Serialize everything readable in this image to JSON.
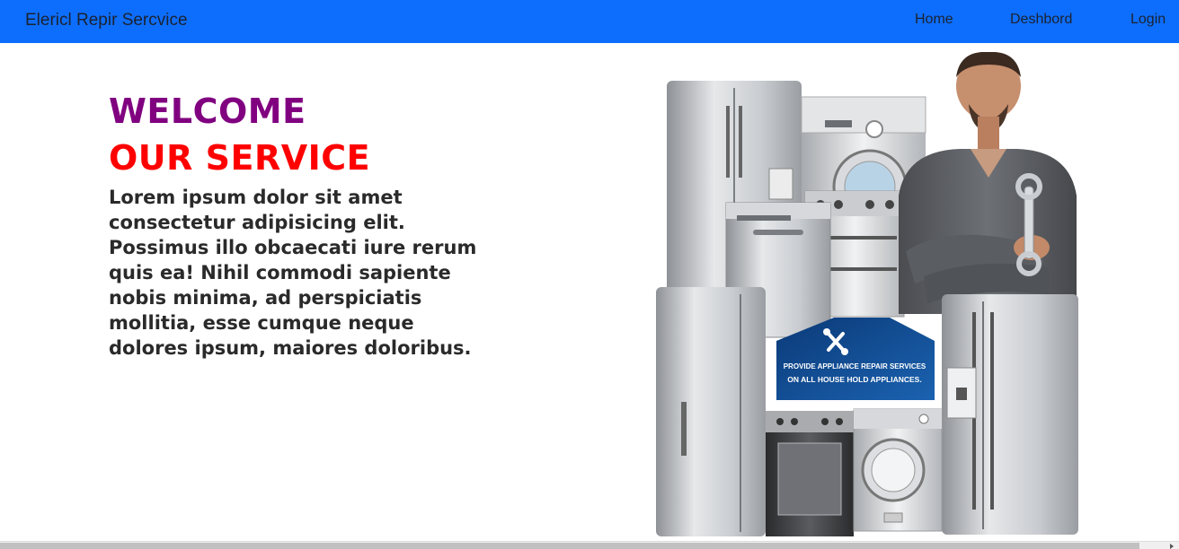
{
  "navbar": {
    "brand": "Elericl Repir Sercvice",
    "links": [
      "Home",
      "Deshbord",
      "Login"
    ],
    "background": "#0d6efd"
  },
  "hero": {
    "title_line1": "WELCOME",
    "title_line2": "OUR SERVICE",
    "title_line1_color": "#800080",
    "title_line2_color": "#ff0000",
    "body": "Lorem ipsum dolor sit amet consectetur adipisicing elit. Possimus illo obcaecati iure rerum quis ea! Nihil commodi sapiente nobis minima, ad perspiciatis mollitia, esse cumque neque dolores ipsum, maiores doloribus."
  },
  "banner": {
    "line1": "PROVIDE APPLIANCE REPAIR SERVICES",
    "line2": "ON ALL HOUSE HOLD APPLIANCES.",
    "icon": "tools-icon"
  }
}
